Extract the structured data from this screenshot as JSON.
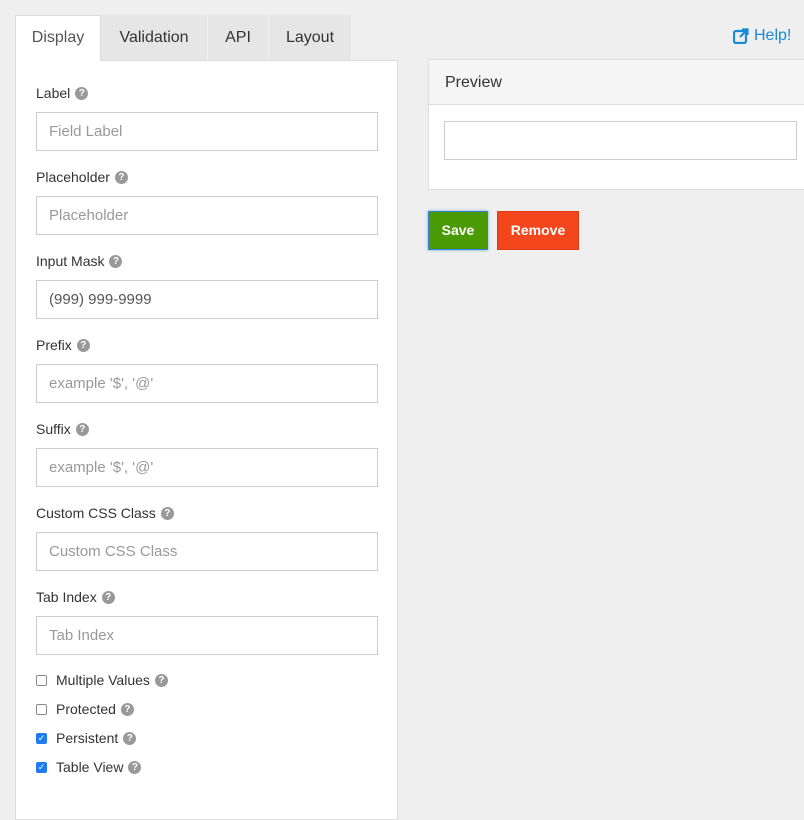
{
  "tabs": [
    {
      "label": "Display",
      "active": true
    },
    {
      "label": "Validation"
    },
    {
      "label": "API"
    },
    {
      "label": "Layout"
    }
  ],
  "help_link": {
    "label": "Help!",
    "icon": "external-link-icon"
  },
  "fields": [
    {
      "label": "Label",
      "placeholder": "Field Label",
      "value": ""
    },
    {
      "label": "Placeholder",
      "placeholder": "Placeholder",
      "value": ""
    },
    {
      "label": "Input Mask",
      "placeholder": "",
      "value": "(999) 999-9999"
    },
    {
      "label": "Prefix",
      "placeholder": "example '$', '@'",
      "value": ""
    },
    {
      "label": "Suffix",
      "placeholder": "example '$', '@'",
      "value": ""
    },
    {
      "label": "Custom CSS Class",
      "placeholder": "Custom CSS Class",
      "value": ""
    },
    {
      "label": "Tab Index",
      "placeholder": "Tab Index",
      "value": ""
    }
  ],
  "checkboxes": [
    {
      "label": "Multiple Values",
      "checked": false
    },
    {
      "label": "Protected",
      "checked": false
    },
    {
      "label": "Persistent",
      "checked": true
    },
    {
      "label": "Table View",
      "checked": true
    }
  ],
  "preview": {
    "title": "Preview"
  },
  "buttons": {
    "save": "Save",
    "remove": "Remove"
  },
  "colors": {
    "save": "#4a9a06",
    "remove": "#f4461c",
    "link": "#1a8ad4",
    "checkbox": "#1e7cf0"
  }
}
